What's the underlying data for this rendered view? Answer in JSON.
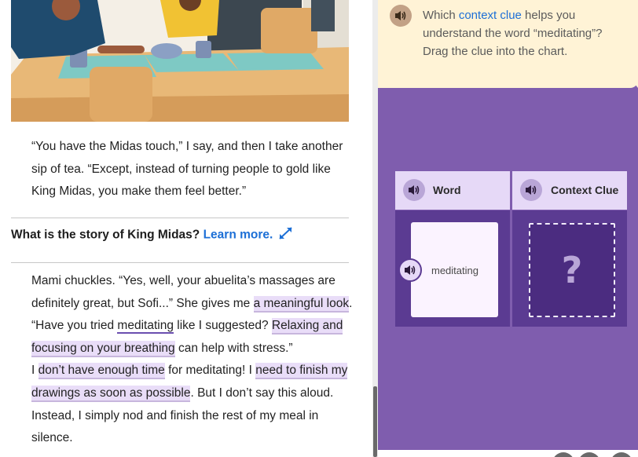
{
  "story": {
    "para1": {
      "segments": [
        "“You have the Midas touch,” I say, and then I take another sip of tea. “Except, instead of turning people to gold like King Midas, you make them feel better.”"
      ]
    },
    "question": {
      "text": "What is the story of King Midas?",
      "link": "Learn more."
    },
    "para2": {
      "s1": "Mami chuckles. “Yes, well, your abuelita’s massages are definitely great, but Sofi...” She gives me ",
      "h1": "a meaningful look",
      "s2": ". “Have you tried ",
      "vocab": "meditating",
      "s3": " like I suggested? ",
      "h2": "Relaxing and focusing on your breathing",
      "s4": " can help with stress.”",
      "s5": "I ",
      "h3": "don’t have enough time",
      "s6": " for meditating! I ",
      "h4": "need to finish my drawings as soon as possible",
      "s7": ". But I don’t say this aloud. Instead, I simply nod and finish the rest of my meal in silence."
    }
  },
  "activity": {
    "prompt_before": "Which ",
    "prompt_link": "context clue",
    "prompt_after": " helps you understand the word “meditating”? Drag the clue into the chart.",
    "columns": {
      "word_header": "Word",
      "clue_header": "Context Clue"
    },
    "word_card": "meditating",
    "drop_placeholder": "?"
  },
  "icons": {
    "audio": "speaker-icon",
    "expand": "expand-arrows-icon"
  },
  "colors": {
    "activity_bg": "#7f5dae",
    "prompt_bg": "#fff3d6",
    "header_bg": "#e6d9f7",
    "highlight": "#e9ddf8",
    "link": "#1c6fd6"
  }
}
